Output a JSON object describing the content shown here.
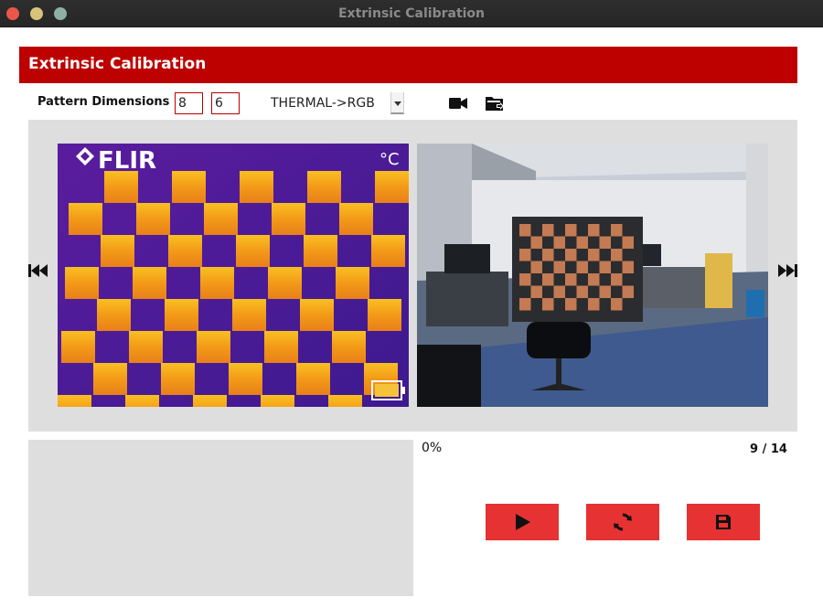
{
  "window": {
    "title": "Extrinsic Calibration"
  },
  "header": {
    "title": "Extrinsic Calibration",
    "color": "#bd0000"
  },
  "toolbar": {
    "pattern_label": "Pattern Dimensions",
    "pattern_width": "8",
    "pattern_height": "6",
    "mode_selected": "THERMAL->RGB",
    "camera_icon": "video-camera-icon",
    "folder_icon": "folder-open-icon"
  },
  "viewer": {
    "prev_icon": "skip-back-icon",
    "next_icon": "skip-forward-icon",
    "thermal_image": {
      "brand_text": "FLIR",
      "unit_text": "°C"
    },
    "rgb_image": {}
  },
  "status": {
    "progress": "0%",
    "counter": "9 / 14"
  },
  "actions": {
    "play_icon": "play-icon",
    "refresh_icon": "refresh-icon",
    "save_icon": "save-icon",
    "color": "#e63232"
  }
}
